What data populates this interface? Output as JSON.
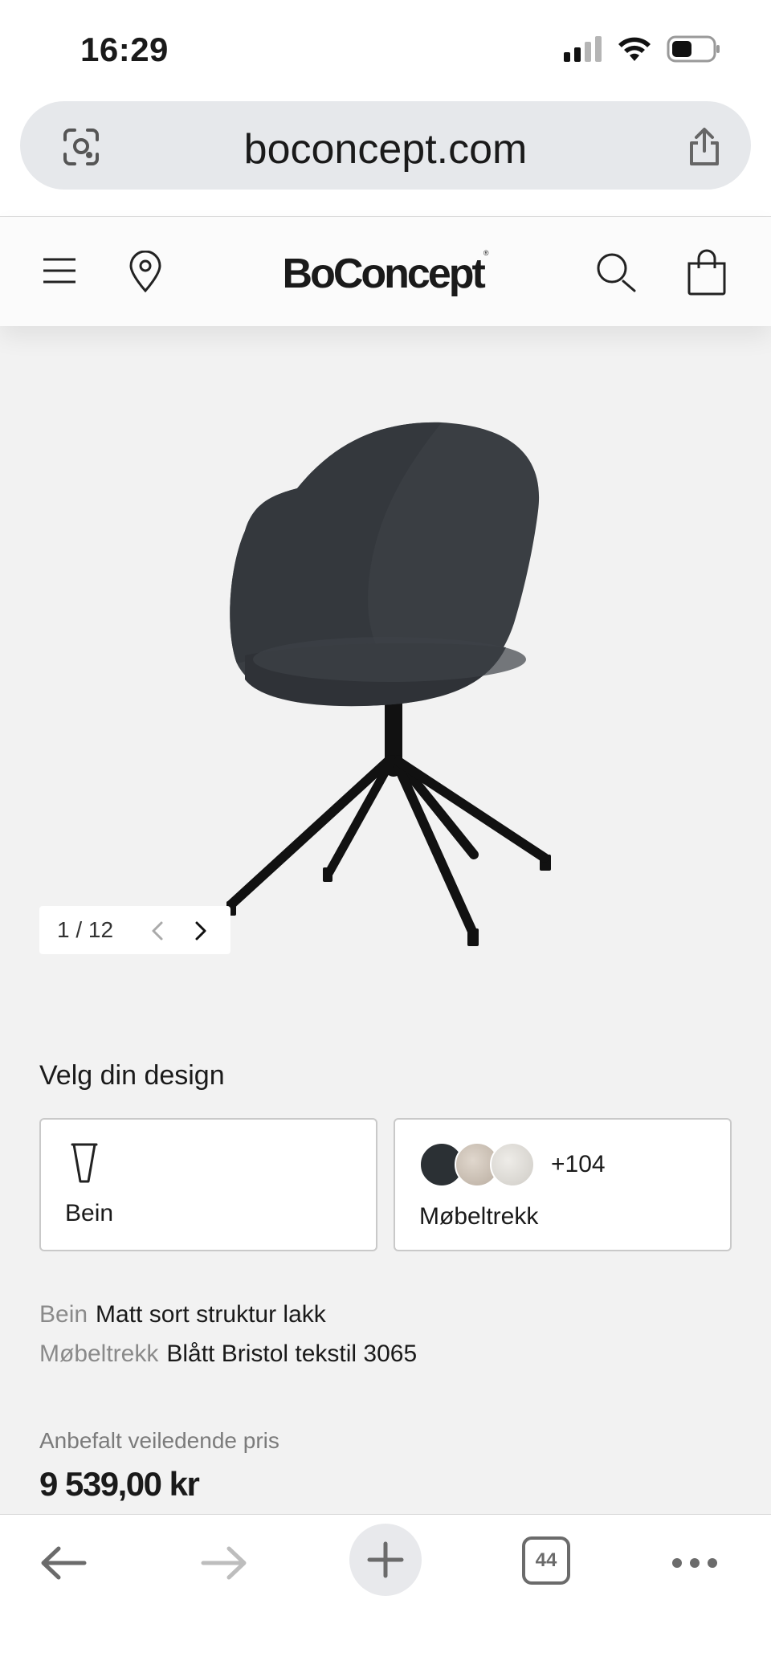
{
  "status_bar": {
    "time": "16:29"
  },
  "browser": {
    "url": "boconcept.com",
    "tab_count": "44"
  },
  "site": {
    "logo": "BoConcept",
    "logo_mark": "®"
  },
  "gallery": {
    "counter": "1 / 12"
  },
  "design": {
    "heading": "Velg din design",
    "legs_card_label": "Bein",
    "upholstery_card_label": "Møbeltrekk",
    "extra_swatches": "+104",
    "swatch_colors": [
      "#2b3034",
      "#c9bfb4",
      "#dcdad6"
    ]
  },
  "specs": [
    {
      "key": "Bein",
      "value": "Matt sort struktur lakk"
    },
    {
      "key": "Møbeltrekk",
      "value": "Blått Bristol tekstil 3065"
    }
  ],
  "price": {
    "caption": "Anbefalt veiledende pris",
    "value": "9 539,00 kr"
  },
  "colors": {
    "page_bg": "#f2f2f2",
    "chair_fabric": "#3a3e43",
    "chair_base": "#111111"
  }
}
